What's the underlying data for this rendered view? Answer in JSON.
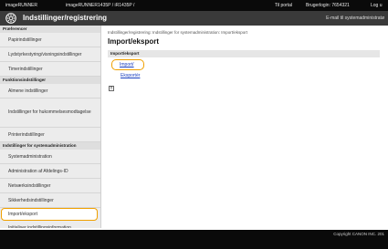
{
  "topbar": {
    "product": "imageRUNNER",
    "model": "imageRUNNER1435P / iR1435P /",
    "portal": "Til portal",
    "login": "Brugerlogin: 7654321",
    "logout": "Log u"
  },
  "header": {
    "title": "Indstillinger/registrering",
    "email_link": "E-mail til systemadministratø"
  },
  "sidebar": {
    "preferences_head": "Præferencer",
    "items_pref": [
      "Papirindstillinger",
      "Lydstyrkestyring/visningsindstillinger",
      "Timerindstillinger"
    ],
    "function_head": "Funktionsindstillinger",
    "items_func": [
      "Almene indstillinger",
      "Indstillinger for hukommelsesmodtagelse",
      "Printerindstillinger"
    ],
    "admin_head": "Indstillinger for systemadministration",
    "items_admin": [
      "Systemadministration",
      "Administration af Afdelings-ID",
      "Netværksindstillinger",
      "Sikkerhedsindstillinger",
      "Import/eksport",
      "Initialiser indstillingsinformation"
    ]
  },
  "main": {
    "breadcrumb": "Indstillinger/registrering: Indstillinger for systemadministration: Import/eksport",
    "page_title": "Import/eksport",
    "section_head": "Import/eksport",
    "link_import": "Import/",
    "link_export": "Eksportér",
    "expand_symbol": "±"
  },
  "footer": {
    "copyright": "Copyright CANON INC. 201"
  }
}
